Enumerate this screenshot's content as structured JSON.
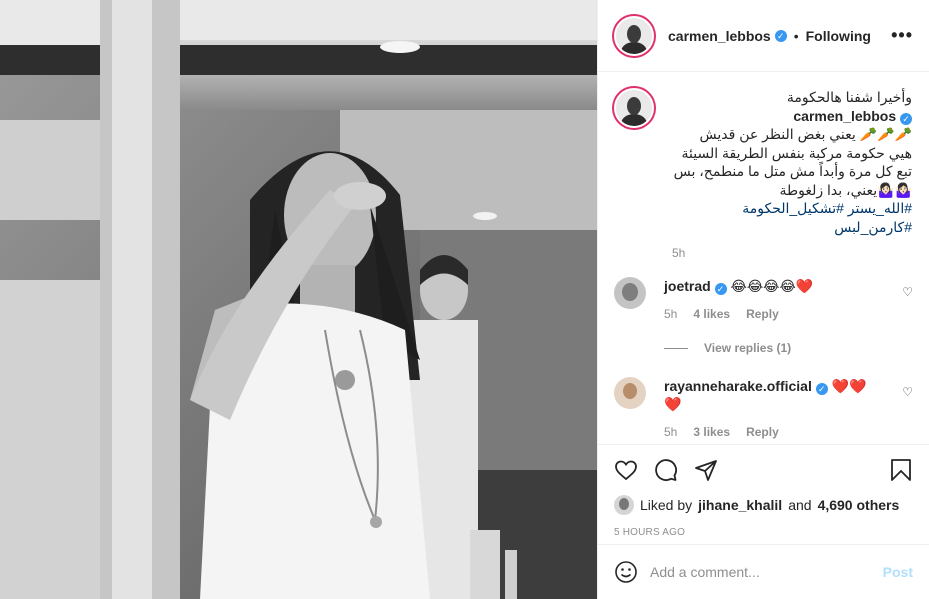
{
  "header": {
    "username": "carmen_lebbos",
    "separator": "•",
    "follow_status": "Following",
    "more_label": "•••"
  },
  "caption": {
    "username": "carmen_lebbos",
    "lines": [
      "وأخيرا شفنا هالحكومة",
      "🥕🥕🥕 يعني بغض النظر عن قديش",
      "هيي حكومة مركبة بنفس الطريقة السيئة",
      "تبع كل مرة وأبداً مش متل ما منطمح، بس",
      "🤷🏻‍♀️🤷🏻‍♀️يعني، بدا زلغوطة"
    ],
    "hashtags": "#الله_يستر #تشكيل_الحكومة #كارمن_لبس",
    "time": "5h"
  },
  "comments": [
    {
      "username": "joetrad",
      "text": "😂😂😂😂❤️",
      "time": "5h",
      "likes": "4 likes",
      "reply": "Reply",
      "view_replies": "View replies (1)"
    },
    {
      "username": "rayanneharake.official",
      "text": "❤️❤️ ❤️",
      "time": "5h",
      "likes": "3 likes",
      "reply": "Reply"
    }
  ],
  "liked_by": {
    "prefix": "Liked by",
    "user": "jihane_khalil",
    "and": "and",
    "count": "4,690 others"
  },
  "posted_ago": "5 HOURS AGO",
  "add_comment": {
    "placeholder": "Add a comment...",
    "post_label": "Post"
  },
  "icons": {
    "like": "heart-icon",
    "comment": "comment-icon",
    "share": "share-icon",
    "save": "bookmark-icon",
    "emoji": "emoji-icon"
  }
}
